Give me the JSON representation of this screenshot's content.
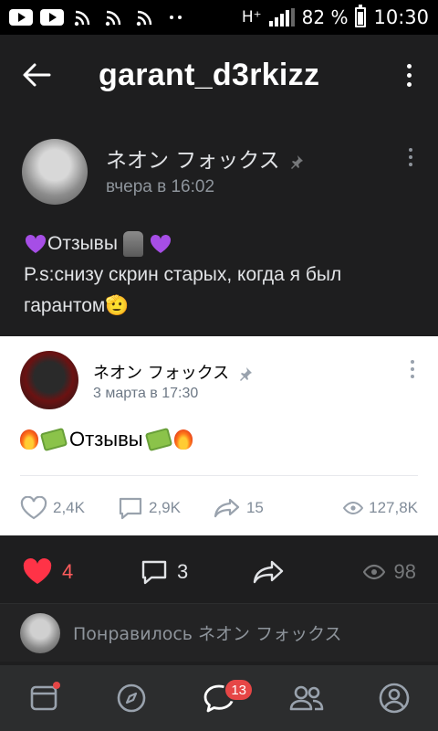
{
  "statusbar": {
    "network": "H⁺",
    "battery": "82 %",
    "time": "10:30"
  },
  "header": {
    "title": "garant_d3rkizz"
  },
  "post": {
    "author": "ネオン フォックス",
    "time": "вчера в 16:02",
    "line1_text": "Отзывы",
    "line2": "P.s:снизу скрин старых, когда я был гарантом🫡"
  },
  "repost": {
    "author": "ネオン フォックス",
    "time": "3 марта в 17:30",
    "text": "Отзывы",
    "likes": "2,4K",
    "comments": "2,9K",
    "shares": "15",
    "views": "127,8K"
  },
  "actions": {
    "likes": "4",
    "comments": "3",
    "views": "98"
  },
  "liked_by": {
    "text": "Понравилось ネオン フォックス"
  },
  "tabbar": {
    "messages_badge": "13"
  }
}
